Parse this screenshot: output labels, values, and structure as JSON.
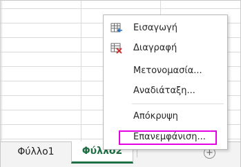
{
  "sheet_tabs": [
    {
      "label": "Φύλλο1"
    },
    {
      "label": "Φύλλο2"
    }
  ],
  "add_sheet_icon": "+",
  "context_menu": {
    "items": [
      {
        "label": "Εισαγωγή",
        "icon": "insert-sheet-icon"
      },
      {
        "label": "Διαγραφή",
        "icon": "delete-sheet-icon"
      },
      {
        "label": "Μετονομασία...",
        "icon": ""
      },
      {
        "label": "Αναδιάταξη...",
        "icon": ""
      },
      {
        "label": "Απόκρυψη",
        "icon": ""
      },
      {
        "label": "Επανεμφάνιση...",
        "icon": ""
      }
    ]
  },
  "colors": {
    "active_tab": "#1d7044",
    "highlight": "#e600e6",
    "delete_x": "#d0312d"
  }
}
